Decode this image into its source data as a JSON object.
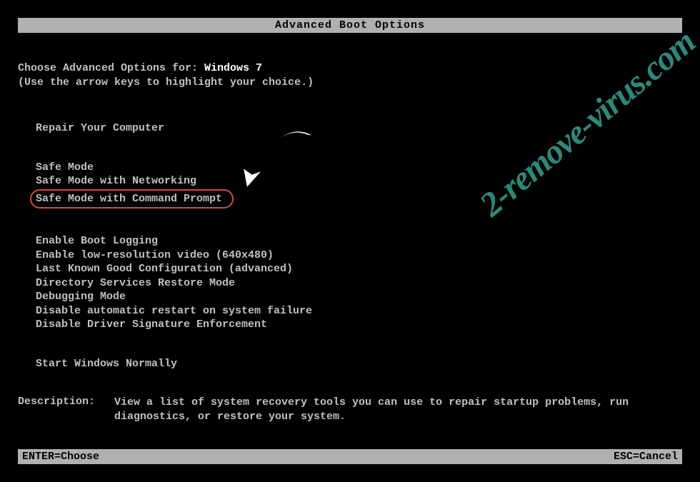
{
  "title": "Advanced Boot Options",
  "intro": {
    "line1_prefix": "Choose Advanced Options for: ",
    "os": "Windows 7",
    "line2": "(Use the arrow keys to highlight your choice.)"
  },
  "menu": {
    "group1": [
      "Repair Your Computer"
    ],
    "group2": [
      "Safe Mode",
      "Safe Mode with Networking",
      "Safe Mode with Command Prompt"
    ],
    "group3": [
      "Enable Boot Logging",
      "Enable low-resolution video (640x480)",
      "Last Known Good Configuration (advanced)",
      "Directory Services Restore Mode",
      "Debugging Mode",
      "Disable automatic restart on system failure",
      "Disable Driver Signature Enforcement"
    ],
    "group4": [
      "Start Windows Normally"
    ]
  },
  "highlighted_item": "Safe Mode with Command Prompt",
  "description": {
    "label": "Description:",
    "text": "View a list of system recovery tools you can use to repair startup problems, run diagnostics, or restore your system."
  },
  "footer": {
    "left": "ENTER=Choose",
    "right": "ESC=Cancel"
  },
  "watermark": "2-remove-virus.com"
}
